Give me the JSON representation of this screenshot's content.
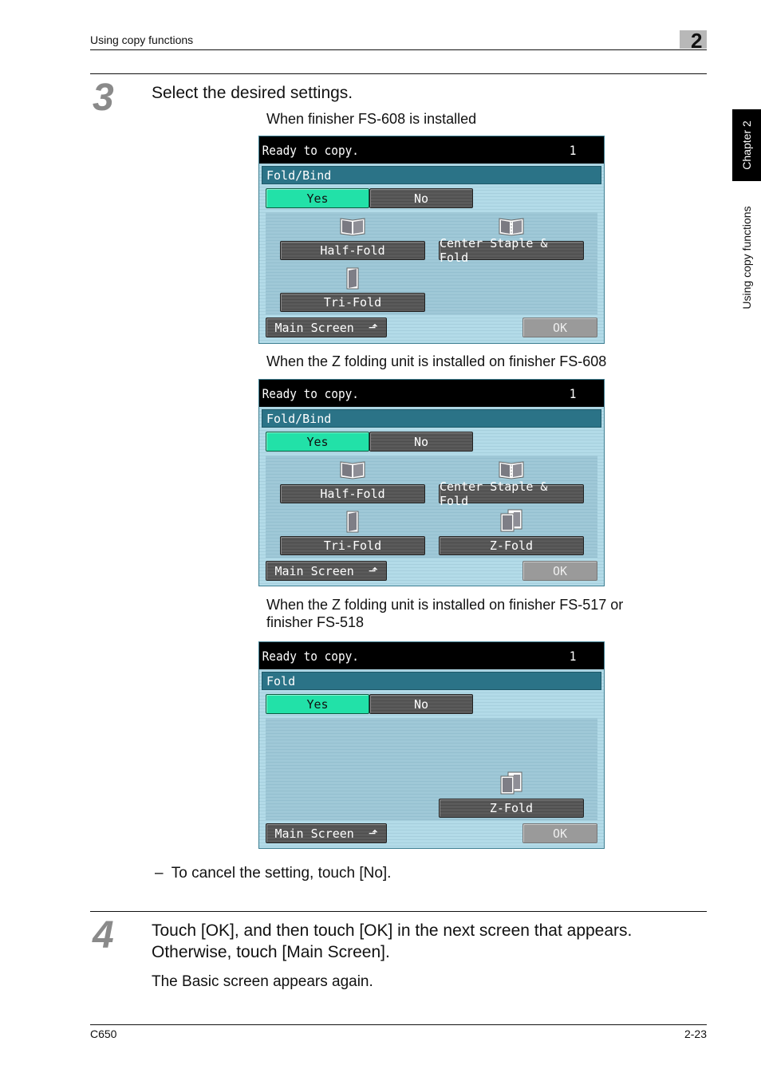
{
  "header": {
    "running_title": "Using copy functions",
    "chapter_number": "2"
  },
  "side_tab": {
    "chapter_label": "Chapter 2",
    "section_label": "Using copy functions"
  },
  "step3": {
    "number": "3",
    "instruction": "Select the desired settings.",
    "note": "To cancel the setting, touch [No].",
    "note_bullet": "–"
  },
  "screens": [
    {
      "caption": "When finisher FS-608 is installed",
      "status": "Ready to copy.",
      "copies": "1",
      "title": "Fold/Bind",
      "yes_label": "Yes",
      "no_label": "No",
      "options": [
        {
          "label": "Half-Fold",
          "icon": "half-fold-icon"
        },
        {
          "label": "Center Staple & Fold",
          "icon": "center-staple-fold-icon"
        },
        {
          "label": "Tri-Fold",
          "icon": "tri-fold-icon"
        }
      ],
      "main_screen_label": "Main Screen",
      "ok_label": "OK"
    },
    {
      "caption": "When the Z folding unit is installed on finisher FS-608",
      "status": "Ready to copy.",
      "copies": "1",
      "title": "Fold/Bind",
      "yes_label": "Yes",
      "no_label": "No",
      "options": [
        {
          "label": "Half-Fold",
          "icon": "half-fold-icon"
        },
        {
          "label": "Center Staple & Fold",
          "icon": "center-staple-fold-icon"
        },
        {
          "label": "Tri-Fold",
          "icon": "tri-fold-icon"
        },
        {
          "label": "Z-Fold",
          "icon": "z-fold-icon"
        }
      ],
      "main_screen_label": "Main Screen",
      "ok_label": "OK"
    },
    {
      "caption_line1": "When the Z folding unit is installed on finisher FS-517 or",
      "caption_line2": "finisher FS-518",
      "status": "Ready to copy.",
      "copies": "1",
      "title": "Fold",
      "yes_label": "Yes",
      "no_label": "No",
      "options": [
        {
          "label": "Z-Fold",
          "icon": "z-fold-icon"
        }
      ],
      "main_screen_label": "Main Screen",
      "ok_label": "OK"
    }
  ],
  "step4": {
    "number": "4",
    "instruction_line1": "Touch [OK], and then touch [OK] in the next screen that appears.",
    "instruction_line2": "Otherwise, touch [Main Screen].",
    "result": "The Basic screen appears again."
  },
  "footer": {
    "model": "C650",
    "page": "2-23"
  },
  "colors": {
    "yes_selected": "#22e1a8",
    "title_bar": "#2b7387",
    "panel_bg": "#b4dce9",
    "button_dark": "#555555",
    "ok_disabled": "#9a9a9a"
  }
}
